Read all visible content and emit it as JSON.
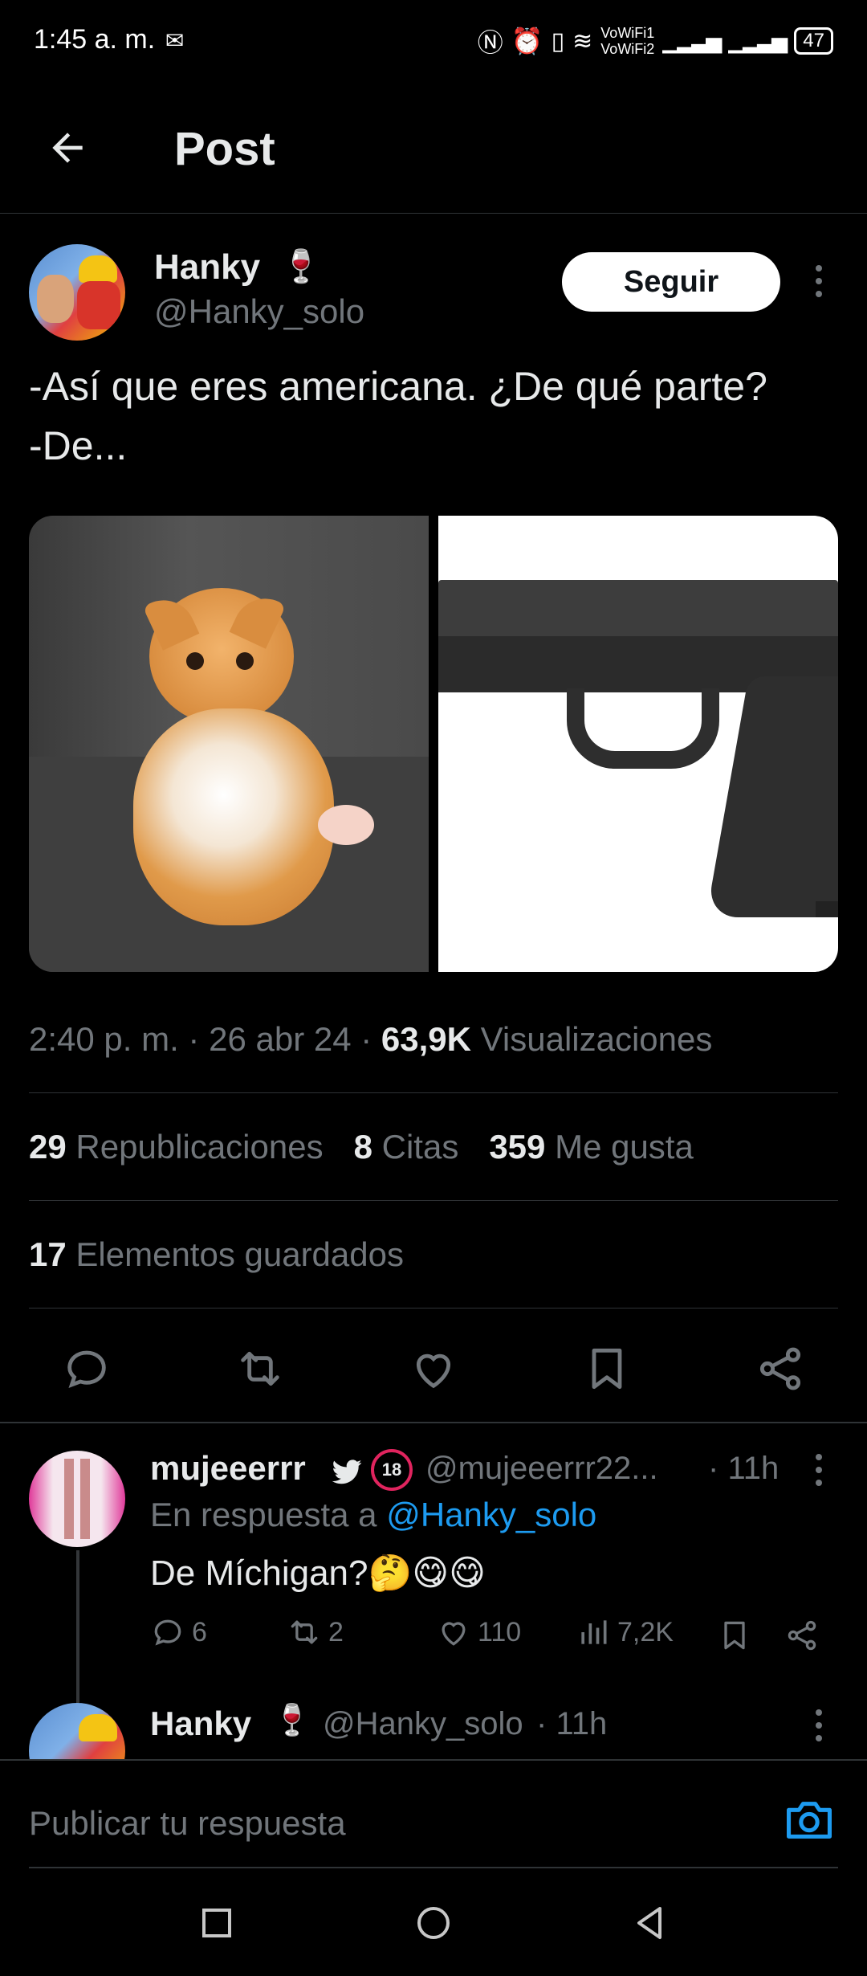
{
  "status_bar": {
    "time": "1:45 a. m.",
    "wifi_label_1": "VoWiFi1",
    "wifi_label_2": "VoWiFi2",
    "battery": "47"
  },
  "header": {
    "title": "Post"
  },
  "post": {
    "author_name": "Hanky",
    "author_handle": "@Hanky_solo",
    "follow_label": "Seguir",
    "text": "-Así que eres americana. ¿De qué parte?\n-De...",
    "time": "2:40 p. m.",
    "date": "26 abr 24",
    "views_count": "63,9K",
    "views_label": "Visualizaciones",
    "reposts_count": "29",
    "reposts_label": "Republicaciones",
    "quotes_count": "8",
    "quotes_label": "Citas",
    "likes_count": "359",
    "likes_label": "Me gusta",
    "bookmarks_count": "17",
    "bookmarks_label": "Elementos guardados",
    "action_icons": [
      "reply-icon",
      "repost-icon",
      "like-icon",
      "bookmark-icon",
      "share-icon"
    ]
  },
  "reply": {
    "author_name": "mujeeerrr",
    "author_handle": "@mujeeerrr22...",
    "time": "11h",
    "reply_to_prefix": "En respuesta a",
    "reply_to_handle": "@Hanky_solo",
    "text": "De Míchigan?🤔😋😋",
    "replies": "6",
    "reposts": "2",
    "likes": "110",
    "views": "7,2K"
  },
  "next_reply": {
    "author_name": "Hanky",
    "author_handle": "@Hanky_solo",
    "time": "11h"
  },
  "compose": {
    "placeholder": "Publicar tu respuesta"
  },
  "colors": {
    "background": "#000000",
    "text": "#e7e9ea",
    "secondary": "#71767b",
    "accent": "#1d9bf0",
    "divider": "#2f3336"
  }
}
